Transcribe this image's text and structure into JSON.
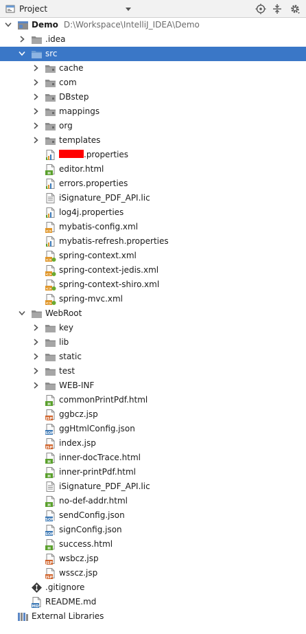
{
  "toolbar": {
    "view_label": "Project",
    "icons": [
      "project-view-icon",
      "dropdown-arrow-icon",
      "locate-icon",
      "collapse-all-icon",
      "settings-icon"
    ]
  },
  "tree": [
    {
      "label": "Demo",
      "path": "D:\\Workspace\\IntelliJ_IDEA\\Demo",
      "level": 0,
      "arrow": "open",
      "icon": "module",
      "bold": true
    },
    {
      "label": ".idea",
      "level": 1,
      "arrow": "closed",
      "icon": "folder"
    },
    {
      "label": "src",
      "level": 1,
      "arrow": "open",
      "icon": "folder-blue",
      "selected": true
    },
    {
      "label": "cache",
      "level": 2,
      "arrow": "closed",
      "icon": "package"
    },
    {
      "label": "com",
      "level": 2,
      "arrow": "closed",
      "icon": "package"
    },
    {
      "label": "DBstep",
      "level": 2,
      "arrow": "closed",
      "icon": "package"
    },
    {
      "label": "mappings",
      "level": 2,
      "arrow": "closed",
      "icon": "package"
    },
    {
      "label": "org",
      "level": 2,
      "arrow": "closed",
      "icon": "package"
    },
    {
      "label": "templates",
      "level": 2,
      "arrow": "closed",
      "icon": "package"
    },
    {
      "label": ".properties",
      "level": 2,
      "icon": "properties",
      "redacted": true
    },
    {
      "label": "editor.html",
      "level": 2,
      "icon": "html"
    },
    {
      "label": "errors.properties",
      "level": 2,
      "icon": "properties"
    },
    {
      "label": "iSignature_PDF_API.lic",
      "level": 2,
      "icon": "text"
    },
    {
      "label": "log4j.properties",
      "level": 2,
      "icon": "properties"
    },
    {
      "label": "mybatis-config.xml",
      "level": 2,
      "icon": "xml"
    },
    {
      "label": "mybatis-refresh.properties",
      "level": 2,
      "icon": "properties"
    },
    {
      "label": "spring-context.xml",
      "level": 2,
      "icon": "spring-xml"
    },
    {
      "label": "spring-context-jedis.xml",
      "level": 2,
      "icon": "spring-xml"
    },
    {
      "label": "spring-context-shiro.xml",
      "level": 2,
      "icon": "spring-xml"
    },
    {
      "label": "spring-mvc.xml",
      "level": 2,
      "icon": "spring-xml"
    },
    {
      "label": "WebRoot",
      "level": 1,
      "arrow": "open",
      "icon": "folder"
    },
    {
      "label": "key",
      "level": 2,
      "arrow": "closed",
      "icon": "folder"
    },
    {
      "label": "lib",
      "level": 2,
      "arrow": "closed",
      "icon": "folder"
    },
    {
      "label": "static",
      "level": 2,
      "arrow": "closed",
      "icon": "folder"
    },
    {
      "label": "test",
      "level": 2,
      "arrow": "closed",
      "icon": "folder"
    },
    {
      "label": "WEB-INF",
      "level": 2,
      "arrow": "closed",
      "icon": "folder"
    },
    {
      "label": "commonPrintPdf.html",
      "level": 2,
      "icon": "html"
    },
    {
      "label": "ggbcz.jsp",
      "level": 2,
      "icon": "jsp"
    },
    {
      "label": "ggHtmlConfig.json",
      "level": 2,
      "icon": "json"
    },
    {
      "label": "index.jsp",
      "level": 2,
      "icon": "jsp"
    },
    {
      "label": "inner-docTrace.html",
      "level": 2,
      "icon": "html"
    },
    {
      "label": "inner-printPdf.html",
      "level": 2,
      "icon": "html"
    },
    {
      "label": "iSignature_PDF_API.lic",
      "level": 2,
      "icon": "text"
    },
    {
      "label": "no-def-addr.html",
      "level": 2,
      "icon": "html"
    },
    {
      "label": "sendConfig.json",
      "level": 2,
      "icon": "json"
    },
    {
      "label": "signConfig.json",
      "level": 2,
      "icon": "json"
    },
    {
      "label": "success.html",
      "level": 2,
      "icon": "html"
    },
    {
      "label": "wsbcz.jsp",
      "level": 2,
      "icon": "jsp"
    },
    {
      "label": "wsscz.jsp",
      "level": 2,
      "icon": "jsp"
    },
    {
      "label": ".gitignore",
      "level": 1,
      "icon": "git"
    },
    {
      "label": "README.md",
      "level": 1,
      "icon": "md"
    },
    {
      "label": "External Libraries",
      "level": 0,
      "icon": "libraries"
    }
  ],
  "colors": {
    "selection": "#3a77c7",
    "folder": "#8c8c8c",
    "folder_source": "#6b9bd2",
    "html_badge": "#5aa02c",
    "jsp_badge": "#d0632a",
    "json_badge": "#3b78b5",
    "xml_badge": "#e0962a",
    "spring_badge": "#6aaa30",
    "redaction": "#ff0000"
  }
}
